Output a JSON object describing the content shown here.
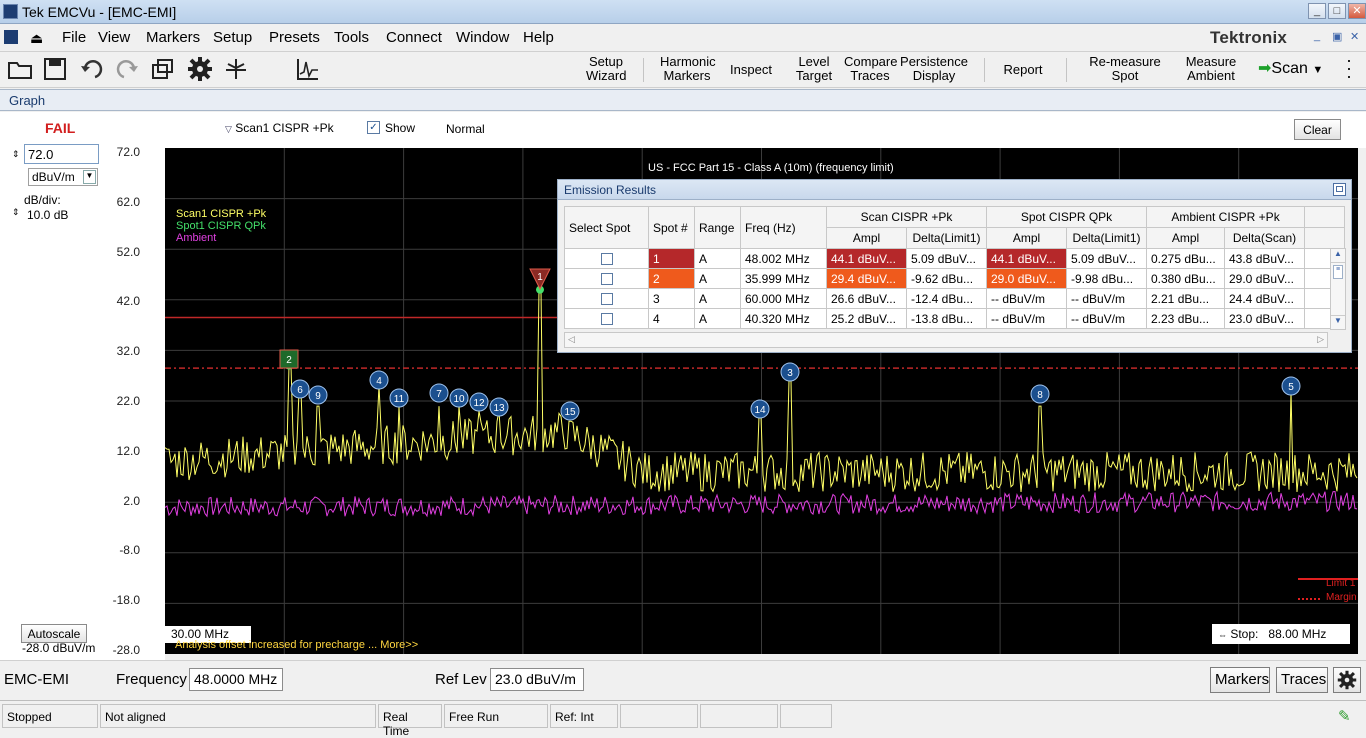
{
  "window": {
    "title": "Tek EMCVu - [EMC-EMI]"
  },
  "menu": {
    "items": [
      "File",
      "View",
      "Markers",
      "Setup",
      "Presets",
      "Tools",
      "Connect",
      "Window",
      "Help"
    ],
    "brand": "Tektronix"
  },
  "toolbar": {
    "setup_wizard": [
      "Setup",
      "Wizard"
    ],
    "harmonic_markers": [
      "Harmonic",
      "Markers"
    ],
    "inspect": "Inspect",
    "level_target": [
      "Level",
      "Target"
    ],
    "compare_traces": [
      "Compare",
      "Traces"
    ],
    "persistence_display": [
      "Persistence",
      "Display"
    ],
    "report": "Report",
    "remeasure_spot": [
      "Re-measure",
      "Spot"
    ],
    "measure_ambient": [
      "Measure",
      "Ambient"
    ],
    "scan": "Scan"
  },
  "graph_tab": "Graph",
  "left": {
    "status": "FAIL",
    "ref_value": "72.0",
    "unit": "dBuV/m",
    "dbdiv_label": "dB/div:",
    "dbdiv_value": "10.0 dB",
    "autoscale": "Autoscale",
    "bottom_ref": "-28.0 dBuV/m"
  },
  "trace_select": {
    "name": "Scan1 CISPR +Pk",
    "show": "Show",
    "mode": "Normal",
    "clear": "Clear"
  },
  "plot": {
    "limit_title": "US - FCC Part 15 - Class A (10m) (frequency limit)",
    "legend": [
      "Scan1 CISPR +Pk",
      "Spot1 CISPR QPk",
      "Ambient"
    ],
    "legend_colors": [
      "#ffff66",
      "#44e06a",
      "#e040e0"
    ],
    "y_ticks": [
      "72.0",
      "62.0",
      "52.0",
      "42.0",
      "32.0",
      "22.0",
      "12.0",
      "2.0",
      "-8.0",
      "-18.0",
      "-28.0"
    ],
    "start": "30.00 MHz",
    "stop_label": "Stop:",
    "stop": "88.00 MHz",
    "message": "Analysis offset increased for precharge ... More>>",
    "limit_legend": [
      "Limit 1",
      "Margin"
    ],
    "markers": [
      "1",
      "2",
      "3",
      "4",
      "5",
      "6",
      "7",
      "8",
      "9",
      "10",
      "11",
      "12",
      "13",
      "14",
      "15"
    ]
  },
  "emission": {
    "title": "Emission Results",
    "group_headers": [
      "Scan CISPR +Pk",
      "Spot CISPR QPk",
      "Ambient CISPR +Pk"
    ],
    "col_headers": [
      "Select Spot",
      "Spot #",
      "Range",
      "Freq (Hz)"
    ],
    "sub_headers": [
      "Ampl",
      "Delta(Limit1)",
      "Ampl",
      "Delta(Limit1)",
      "Ampl",
      "Delta(Scan)"
    ],
    "rows": [
      [
        "1",
        "A",
        "48.002 MHz",
        "44.1 dBuV...",
        "5.09 dBuV...",
        "44.1 dBuV...",
        "5.09 dBuV...",
        "0.275 dBu...",
        "43.8 dBuV..."
      ],
      [
        "2",
        "A",
        "35.999 MHz",
        "29.4 dBuV...",
        "-9.62 dBu...",
        "29.0 dBuV...",
        "-9.98 dBu...",
        "0.380 dBu...",
        "29.0 dBuV..."
      ],
      [
        "3",
        "A",
        "60.000 MHz",
        "26.6 dBuV...",
        "-12.4 dBu...",
        "-- dBuV/m",
        "-- dBuV/m",
        "2.21 dBu...",
        "24.4 dBuV..."
      ],
      [
        "4",
        "A",
        "40.320 MHz",
        "25.2 dBuV...",
        "-13.8 dBu...",
        "-- dBuV/m",
        "-- dBuV/m",
        "2.23 dBu...",
        "23.0 dBuV..."
      ]
    ]
  },
  "bottom": {
    "mode": "EMC-EMI",
    "freq_label": "Frequency",
    "freq_value": "48.0000 MHz",
    "reflev_label": "Ref Lev",
    "reflev_value": "23.0 dBuV/m",
    "markers_btn": "Markers",
    "traces_btn": "Traces"
  },
  "status": {
    "state": "Stopped",
    "align": "Not aligned",
    "realtime": "Real Time",
    "run": "Free Run",
    "ref": "Ref: Int"
  }
}
